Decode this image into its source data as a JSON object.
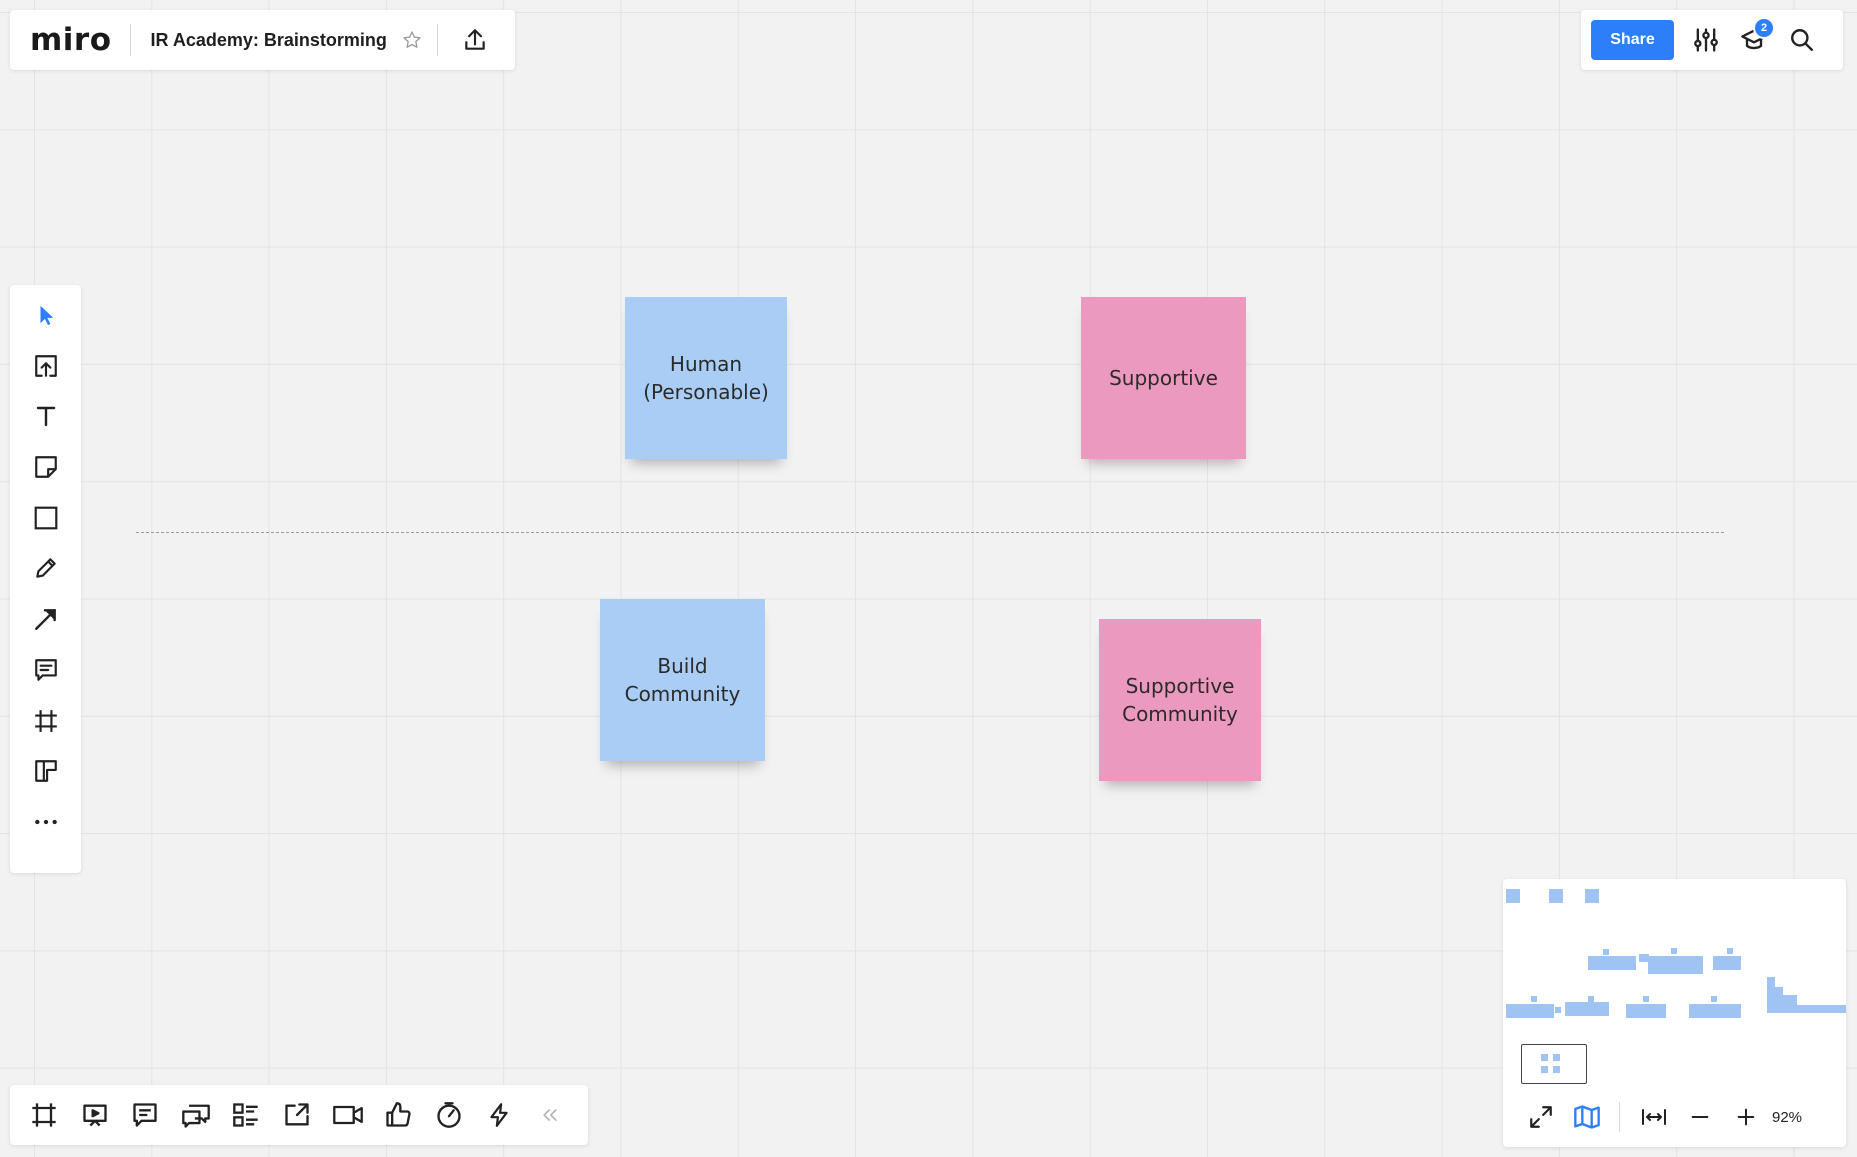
{
  "app": {
    "logo_text": "miro",
    "board_title": "IR Academy: Brainstorming"
  },
  "header": {
    "share_label": "Share",
    "notification_count": "2"
  },
  "left_toolbar": {
    "tools": [
      {
        "name": "select-tool",
        "icon": "cursor-arrow-icon"
      },
      {
        "name": "upload-tool",
        "icon": "upload-icon"
      },
      {
        "name": "text-tool",
        "icon": "text-icon"
      },
      {
        "name": "sticky-note-tool",
        "icon": "sticky-note-icon"
      },
      {
        "name": "shape-tool",
        "icon": "square-icon"
      },
      {
        "name": "pen-tool",
        "icon": "pen-icon"
      },
      {
        "name": "arrow-tool",
        "icon": "arrow-icon"
      },
      {
        "name": "comment-tool",
        "icon": "comment-icon"
      },
      {
        "name": "frame-tool",
        "icon": "frame-icon"
      },
      {
        "name": "templates-tool",
        "icon": "templates-icon"
      },
      {
        "name": "more-tools",
        "icon": "more-dots-icon"
      }
    ]
  },
  "bottom_toolbar": {
    "tools": [
      "frames-icon",
      "presentation-icon",
      "comments-icon",
      "chat-icon",
      "cards-icon",
      "share-screen-icon",
      "video-call-icon",
      "voting-icon",
      "timer-icon",
      "lightning-icon",
      "collapse-icon"
    ]
  },
  "stickies": [
    {
      "text": "Human (Personable)",
      "color": "#a9cdf5"
    },
    {
      "text": "Supportive",
      "color": "#eb99bf"
    },
    {
      "text": "Build Community",
      "color": "#a9cdf5"
    },
    {
      "text": "Supportive Community",
      "color": "#eb99bf"
    }
  ],
  "minimap": {
    "zoom_label": "92%"
  },
  "colors": {
    "accent": "#2d7ff9",
    "sticky_blue": "#a9cdf5",
    "sticky_pink": "#eb99bf",
    "minimap_blocks": "#9fc3f2"
  }
}
